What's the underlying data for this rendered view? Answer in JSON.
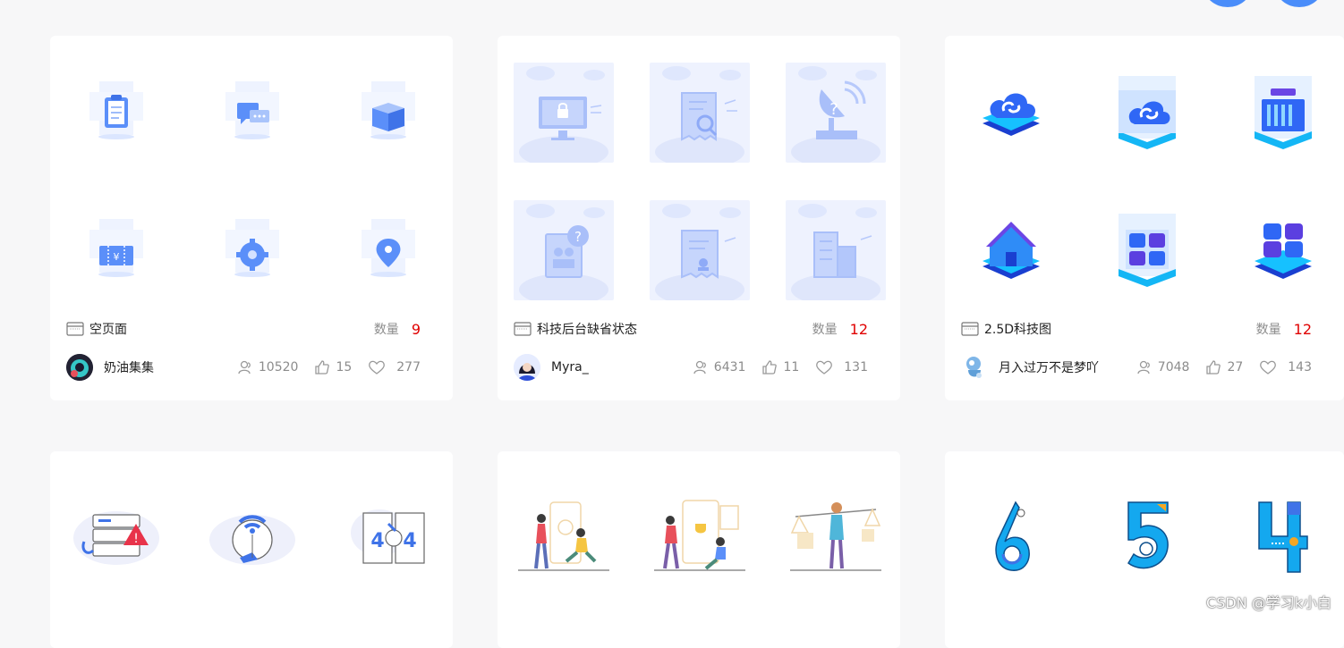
{
  "cards": [
    {
      "title": "空页面",
      "count_label": "数量",
      "count": "9",
      "author": "奶油集集",
      "views": "10520",
      "likes": "15",
      "favorites": "277",
      "icons": [
        "clipboard-icon",
        "chat-icon",
        "box-icon",
        "ticket-icon",
        "gear-icon",
        "location-pin-icon"
      ]
    },
    {
      "title": "科技后台缺省状态",
      "count_label": "数量",
      "count": "12",
      "author": "Myra_",
      "views": "6431",
      "likes": "11",
      "favorites": "131",
      "icons": [
        "locked-monitor-icon",
        "document-search-icon",
        "satellite-dish-icon",
        "contacts-book-icon",
        "certificate-icon",
        "building-icon"
      ]
    },
    {
      "title": "2.5D科技图",
      "count_label": "数量",
      "count": "12",
      "author": "月入过万不是梦吖",
      "views": "7048",
      "likes": "27",
      "favorites": "143",
      "icons": [
        "cloud-link-icon",
        "cloud-panel-icon",
        "server-rack-icon",
        "house-icon",
        "grid-panel-icon",
        "app-blocks-icon"
      ]
    }
  ],
  "bottom_cards": [
    {
      "icons": [
        "server-error-icon",
        "broken-wifi-globe-icon",
        "404-icon"
      ]
    },
    {
      "icons": [
        "people-phone-illustration",
        "people-trophy-illustration",
        "person-scale-illustration"
      ]
    },
    {
      "icons": [
        "number-six-illustration",
        "number-five-illustration",
        "number-four-illustration"
      ]
    }
  ],
  "watermark": "CSDN @学习k小白",
  "colors": {
    "count": "#e00000",
    "accent": "#4a8dfa",
    "muted": "#8c8c8c"
  }
}
